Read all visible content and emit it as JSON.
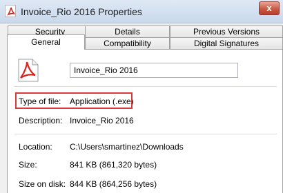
{
  "window": {
    "title": "Invoice_Rio 2016 Properties",
    "close_label": "x"
  },
  "tabs": {
    "row1": [
      "Security",
      "Details",
      "Previous Versions"
    ],
    "row2": [
      "General",
      "Compatibility",
      "Digital Signatures"
    ],
    "active": "General"
  },
  "general": {
    "file_name": "Invoice_Rio 2016",
    "type_label": "Type of file:",
    "type_value": "Application (.exe)",
    "description_label": "Description:",
    "description_value": "Invoice_Rio 2016",
    "location_label": "Location:",
    "location_value": "C:\\Users\\smartinez\\Downloads",
    "size_label": "Size:",
    "size_value": "841 KB (861,320 bytes)",
    "size_on_disk_label": "Size on disk:",
    "size_on_disk_value": "844 KB (864,256 bytes)"
  },
  "icons": {
    "app": "pdf-document-icon",
    "file": "pdf-document-icon"
  },
  "colors": {
    "highlight": "#d63a3a",
    "pdf_red": "#d9231f"
  }
}
